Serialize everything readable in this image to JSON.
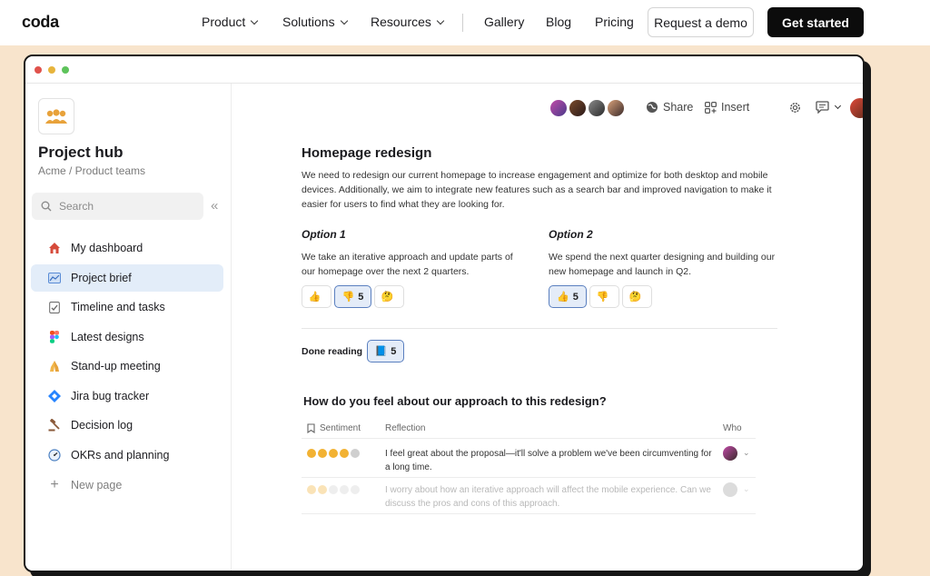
{
  "site": {
    "logo": "coda",
    "nav": [
      "Product",
      "Solutions",
      "Resources",
      "Gallery",
      "Blog",
      "Pricing"
    ],
    "demo_label": "Request a demo",
    "start_label": "Get started"
  },
  "sidebar": {
    "title": "Project hub",
    "subtitle": "Acme / Product teams",
    "search_placeholder": "Search",
    "items": [
      {
        "label": "My dashboard",
        "icon": "house-icon"
      },
      {
        "label": "Project brief",
        "icon": "chart-icon"
      },
      {
        "label": "Timeline and tasks",
        "icon": "clipboard-icon"
      },
      {
        "label": "Latest designs",
        "icon": "figma-icon"
      },
      {
        "label": "Stand-up meeting",
        "icon": "hands-icon"
      },
      {
        "label": "Jira bug tracker",
        "icon": "jira-icon"
      },
      {
        "label": "Decision log",
        "icon": "gavel-icon"
      },
      {
        "label": "OKRs and planning",
        "icon": "gauge-icon"
      }
    ],
    "new_page": "New page"
  },
  "toolbar": {
    "share": "Share",
    "insert": "Insert"
  },
  "doc": {
    "title": "Homepage redesign",
    "intro": "We need to redesign our current homepage to increase engagement and optimize for both desktop and mobile devices. Additionally, we aim to integrate new features such as a search bar and improved navigation to make it easier for users to find what they are looking for.",
    "option1": {
      "title": "Option 1",
      "text": "We take an iterative approach and update parts of our homepage over the next 2 quarters.",
      "reactions": [
        "",
        "5",
        ""
      ]
    },
    "option2": {
      "title": "Option 2",
      "text": "We spend the next quarter designing and building our new homepage and launch in Q2.",
      "reactions": [
        "5",
        "",
        ""
      ]
    },
    "done_label": "Done reading",
    "done_count": "5",
    "question": "How do you feel about our approach to this redesign?",
    "table": {
      "headers": [
        "Sentiment",
        "Reflection",
        "Who"
      ],
      "rows": [
        {
          "reflection": "I feel great about the proposal—it'll solve a problem we've been circumventing for a long time."
        },
        {
          "reflection": "I worry about how an iterative approach will affect the mobile experience. Can we discuss the pros and cons of this approach."
        }
      ]
    }
  },
  "colors": {
    "background": "#f8e4cc",
    "accent": "#5a7fbf",
    "active_item": "#e3edf9"
  }
}
